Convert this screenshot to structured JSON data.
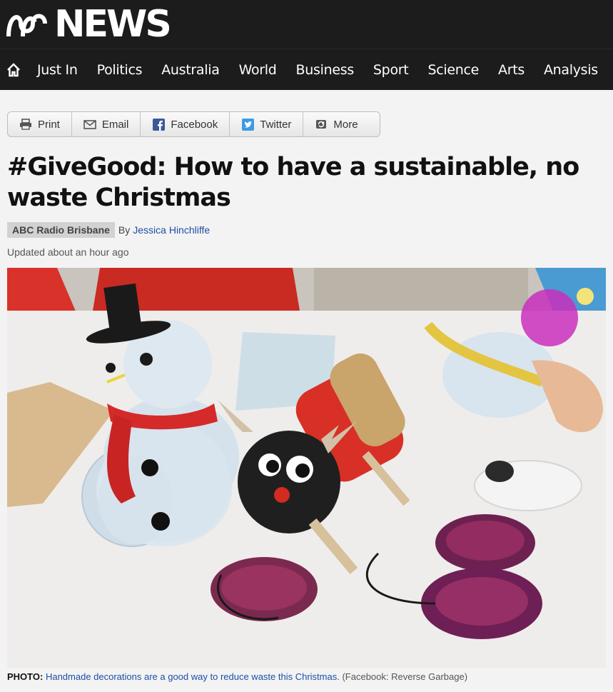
{
  "masthead": {
    "logo_text": "NEWS"
  },
  "nav": {
    "items": [
      {
        "label": "Just In"
      },
      {
        "label": "Politics"
      },
      {
        "label": "Australia"
      },
      {
        "label": "World"
      },
      {
        "label": "Business"
      },
      {
        "label": "Sport"
      },
      {
        "label": "Science"
      },
      {
        "label": "Arts"
      },
      {
        "label": "Analysis"
      }
    ]
  },
  "share": {
    "print": "Print",
    "email": "Email",
    "facebook": "Facebook",
    "twitter": "Twitter",
    "more": "More"
  },
  "article": {
    "headline": "#GiveGood: How to have a sustainable, no waste Christmas",
    "source": "ABC Radio Brisbane",
    "by": "By",
    "author": "Jessica Hinchliffe",
    "updated": "Updated about an hour ago"
  },
  "photo": {
    "label": "PHOTO:",
    "caption": "Handmade decorations are a good way to reduce waste this Christmas.",
    "credit": "(Facebook: Reverse Garbage)"
  },
  "colors": {
    "masthead_bg": "#1c1c1c",
    "link_blue": "#1d4fa3",
    "page_bg": "#f3f3f3"
  },
  "icons": [
    "abc-logo-icon",
    "home-icon",
    "print-icon",
    "email-icon",
    "facebook-icon",
    "twitter-icon",
    "share-more-icon"
  ]
}
